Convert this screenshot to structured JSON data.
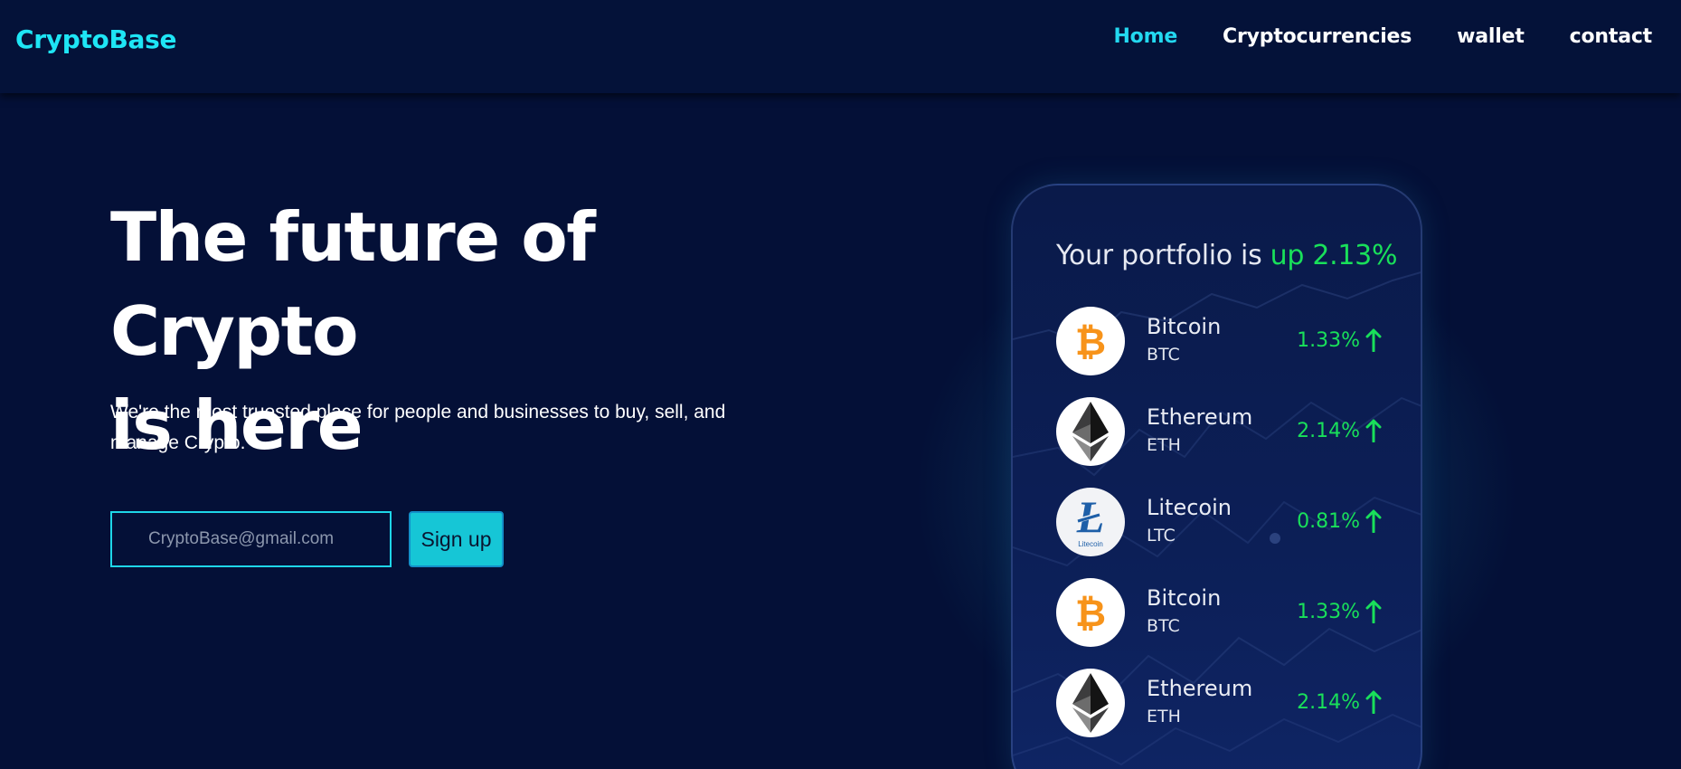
{
  "brand": {
    "name": "CryptoBase",
    "accent": "#1ee5f5"
  },
  "nav": {
    "items": [
      {
        "label": "Home",
        "active": true
      },
      {
        "label": "Cryptocurrencies",
        "active": false
      },
      {
        "label": "wallet",
        "active": false
      },
      {
        "label": "contact",
        "active": false
      }
    ]
  },
  "hero": {
    "title_line1": "The future of Crypto",
    "title_line2": "is here",
    "subtitle": "We're the most truested place for people and businesses to buy, sell, and manage Crypto.",
    "email_placeholder": "CryptoBase@gmail.com",
    "signup_label": "Sign up"
  },
  "portfolio": {
    "title_prefix": "Your portfolio is",
    "title_highlight": "up 2.13%",
    "positive_color": "#19e05a",
    "coins": [
      {
        "name": "Bitcoin",
        "ticker": "BTC",
        "change": "1.33%",
        "icon": "bitcoin-icon"
      },
      {
        "name": "Ethereum",
        "ticker": "ETH",
        "change": "2.14%",
        "icon": "ethereum-icon"
      },
      {
        "name": "Litecoin",
        "ticker": "LTC",
        "change": "0.81%",
        "icon": "litecoin-icon",
        "icon_text": "Litecoin"
      },
      {
        "name": "Bitcoin",
        "ticker": "BTC",
        "change": "1.33%",
        "icon": "bitcoin-icon"
      },
      {
        "name": "Ethereum",
        "ticker": "ETH",
        "change": "2.14%",
        "icon": "ethereum-icon"
      }
    ]
  }
}
